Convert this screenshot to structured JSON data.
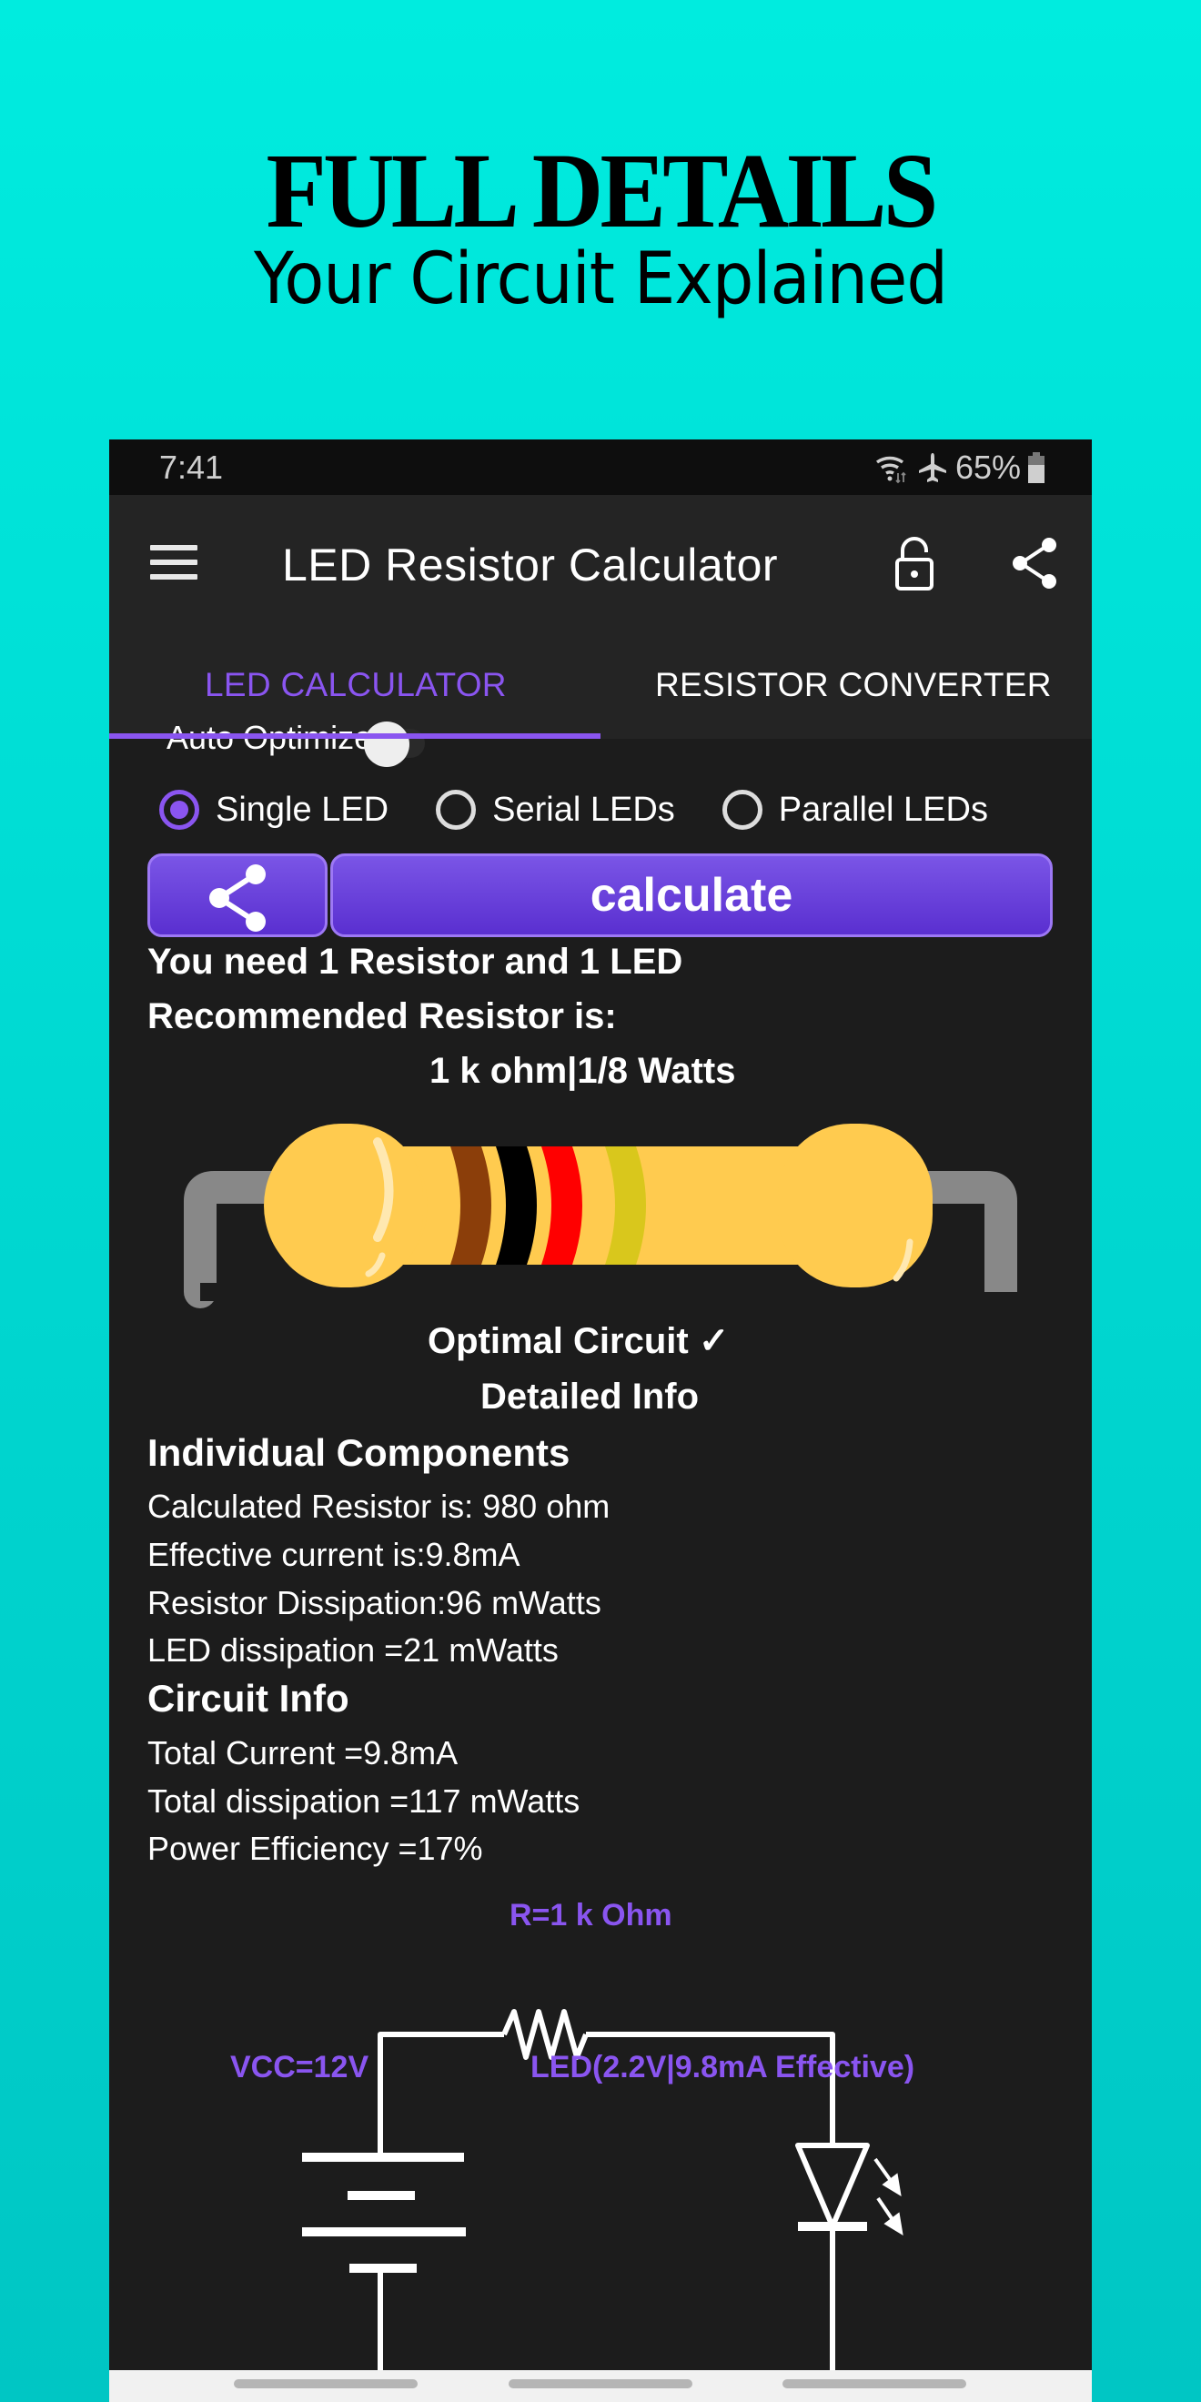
{
  "promo": {
    "headline": "FULL DETAILS",
    "subheadline": "Your Circuit Explained"
  },
  "status_bar": {
    "time": "7:41",
    "battery": "65%",
    "icons": [
      "wifi-icon",
      "airplane-icon",
      "battery-icon"
    ]
  },
  "app_bar": {
    "title": "LED Resistor Calculator",
    "icons": [
      "menu-icon",
      "unlock-icon",
      "share-icon"
    ]
  },
  "tabs": [
    {
      "label": "LED CALCULATOR",
      "active": true
    },
    {
      "label": "RESISTOR CONVERTER",
      "active": false
    }
  ],
  "auto_optimize": {
    "label": "Auto Optimize",
    "on": false
  },
  "led_mode": {
    "options": [
      "Single LED",
      "Serial LEDs",
      "Parallel LEDs"
    ],
    "selected": "Single LED"
  },
  "actions": {
    "calculate_label": "calculate"
  },
  "result": {
    "need": "You need 1 Resistor and 1 LED",
    "recommended_label": "Recommended Resistor is:",
    "recommended_value": "1 k ohm|1/8 Watts",
    "bands": [
      "brown",
      "black",
      "red",
      "gold"
    ],
    "band_colors": [
      "#8B3E0A",
      "#000000",
      "#FF0000",
      "#D9C71C"
    ],
    "optimal": "Optimal Circuit ✓",
    "detailed": "Detailed Info"
  },
  "individual": {
    "heading": "Individual Components",
    "rows": [
      "Calculated Resistor is: 980 ohm",
      "Effective current is:9.8mA",
      "Resistor Dissipation:96 mWatts",
      "LED dissipation =21 mWatts"
    ]
  },
  "circuit_info": {
    "heading": "Circuit Info",
    "rows": [
      "Total Current =9.8mA",
      "Total dissipation =117 mWatts",
      "Power Efficiency =17%"
    ]
  },
  "diagram": {
    "resistor_label": "R=1 k Ohm",
    "vcc_label": "VCC=12V",
    "led_label": "LED(2.2V|9.8mA Effective)"
  },
  "colors": {
    "accent": "#8A55F0",
    "background": "#1C1C1C",
    "appbar": "#242424",
    "promo_bg": "#00E5DC"
  }
}
